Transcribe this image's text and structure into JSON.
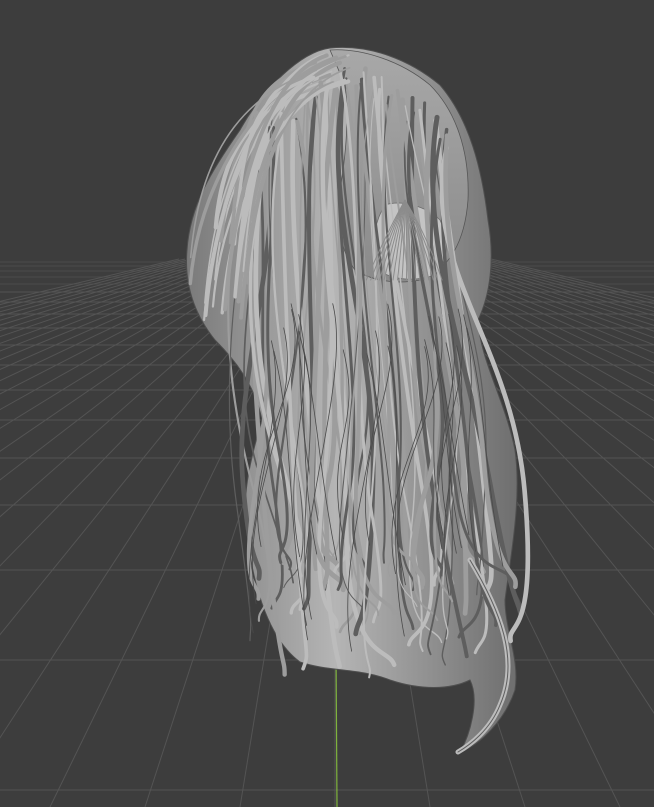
{
  "viewport": {
    "mode": "perspective-3d",
    "background_color": "#3d3d3d",
    "grid_color": "#545454",
    "horizon_grid_color": "#4a4a4a",
    "z_axis_color": "#7fb33c",
    "model": "long-hair-mesh",
    "shading": "solid",
    "model_base_color": "#9d9d9d",
    "model_light_color": "#bcbcbc",
    "model_shadow_color": "#5e5e5e"
  }
}
